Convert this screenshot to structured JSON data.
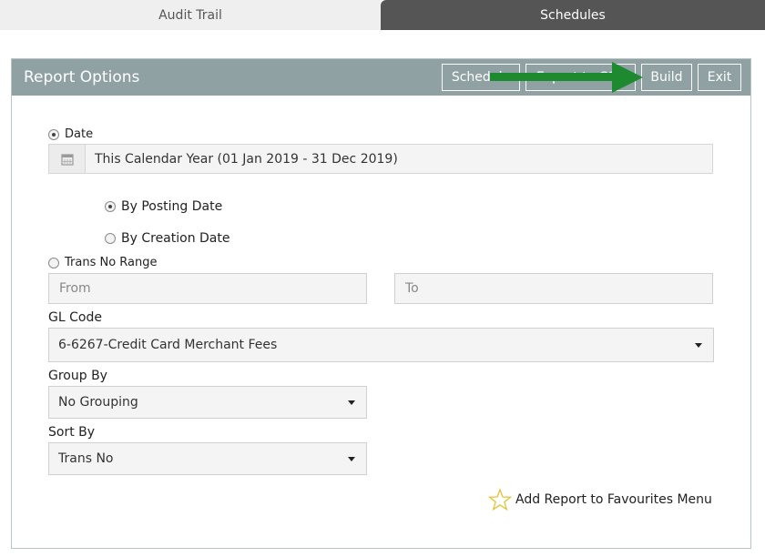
{
  "tabs": [
    {
      "label": "Audit Trail"
    },
    {
      "label": "Schedules"
    }
  ],
  "panel": {
    "title": "Report Options",
    "buttons": {
      "schedule": "Schedule",
      "export": "Export to CSV",
      "build": "Build",
      "exit": "Exit"
    }
  },
  "date_option": {
    "label": "Date",
    "selected": true,
    "value": "This Calendar Year (01 Jan 2019 - 31 Dec 2019)",
    "icon": "calendar-icon"
  },
  "date_type": {
    "posting": "By Posting Date",
    "creation": "By Creation Date",
    "selected": "By Posting Date"
  },
  "trans_no_range": {
    "label": "Trans No Range",
    "from_placeholder": "From",
    "to_placeholder": "To"
  },
  "gl_code": {
    "label": "GL Code",
    "value": "6-6267-Credit Card Merchant Fees"
  },
  "group_by": {
    "label": "Group By",
    "value": "No Grouping"
  },
  "sort_by": {
    "label": "Sort By",
    "value": "Trans No"
  },
  "favourites": {
    "label": "Add Report to Favourites Menu",
    "icon": "star-icon"
  },
  "colors": {
    "header": "#8fa1a3",
    "active_tab": "#555555",
    "arrow": "#1e8a2f"
  }
}
